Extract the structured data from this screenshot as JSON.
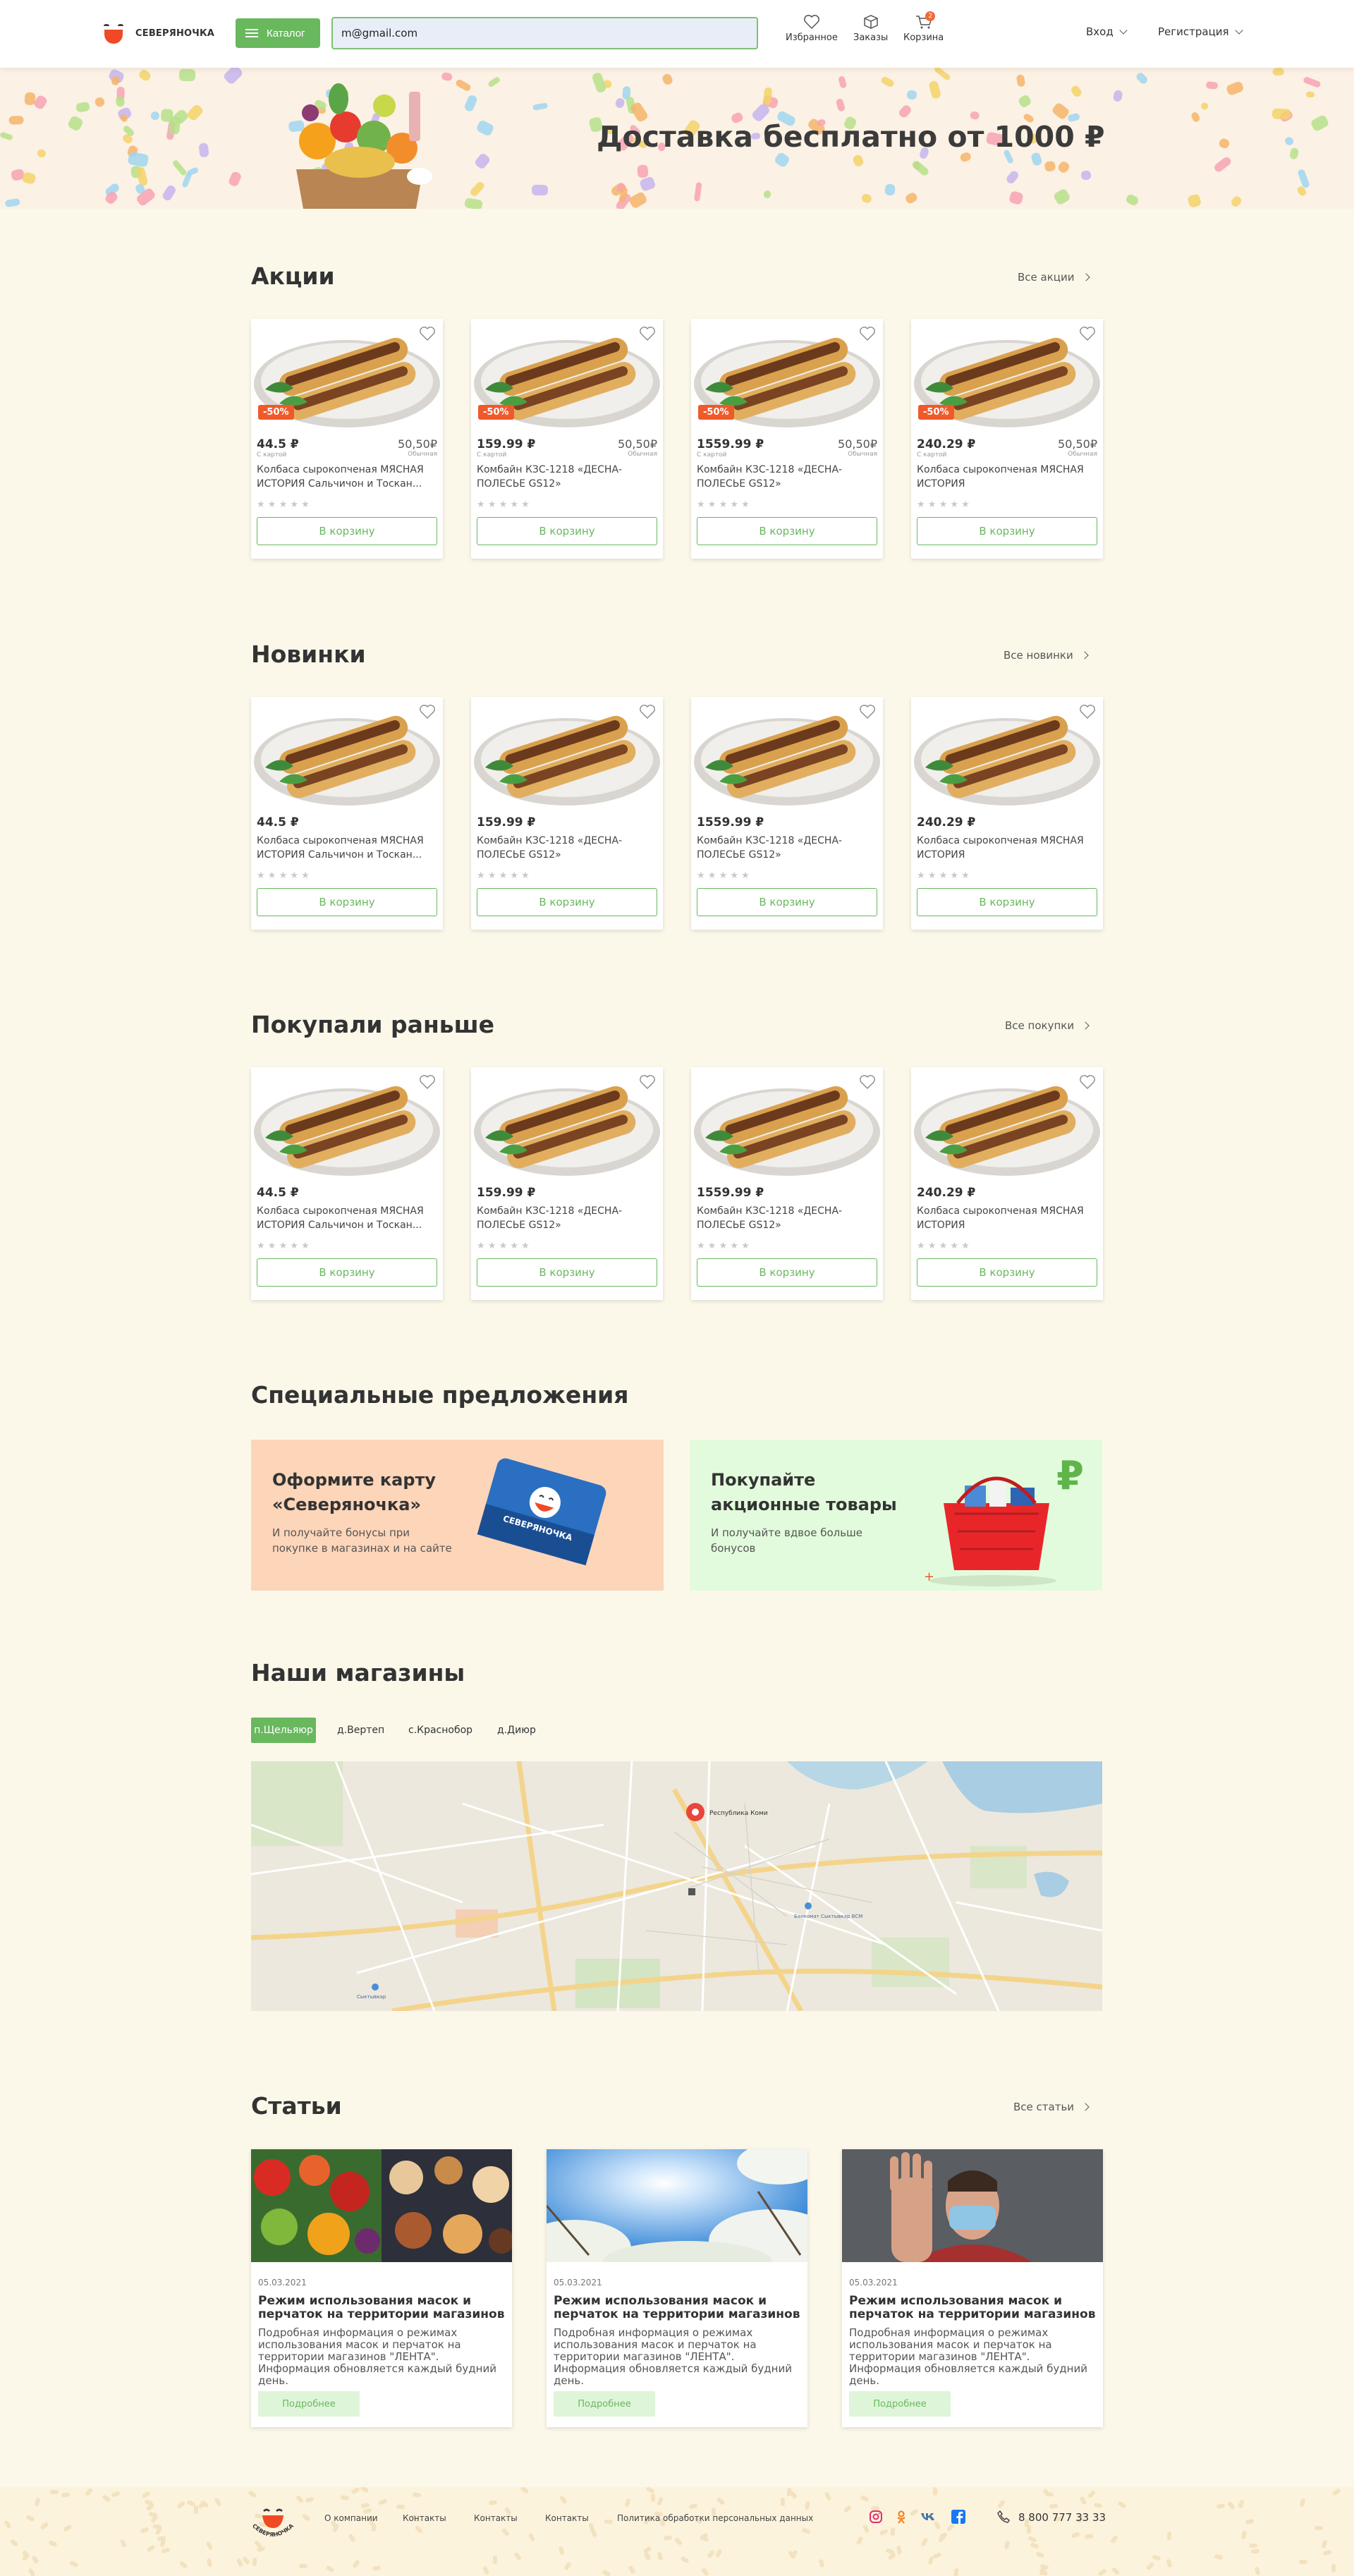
{
  "header": {
    "logo_text": "СЕВЕРЯНОЧКА",
    "catalog_label": "Каталог",
    "search_value": "m@gmail.com",
    "favorites_label": "Избранное",
    "orders_label": "Заказы",
    "cart_label": "Корзина",
    "cart_count": "2",
    "login_label": "Вход",
    "register_label": "Регистрация"
  },
  "hero": {
    "title": "Доставка бесплатно от 1000 ₽"
  },
  "sections": {
    "sales": {
      "title": "Акции",
      "link": "Все акции"
    },
    "new": {
      "title": "Новинки",
      "link": "Все новинки"
    },
    "bought": {
      "title": "Покупали раньше",
      "link": "Все покупки"
    },
    "special": {
      "title": "Специальные предложения"
    },
    "stores": {
      "title": "Наши магазины"
    },
    "articles": {
      "title": "Статьи",
      "link": "Все статьи"
    }
  },
  "products": [
    {
      "price": "44.5 ₽",
      "price_note": "С картой",
      "old": "50,50₽",
      "old_note": "Обычная",
      "discount": "-50%",
      "name": "Колбаса сырокопченая МЯСНАЯ ИСТОРИЯ Сальчичон и Тоскан..."
    },
    {
      "price": "159.99 ₽",
      "price_note": "С картой",
      "old": "50,50₽",
      "old_note": "Обычная",
      "discount": "-50%",
      "name": "Комбайн КЗС-1218 «ДЕСНА-ПОЛЕСЬЕ GS12»"
    },
    {
      "price": "1559.99 ₽",
      "price_note": "С картой",
      "old": "50,50₽",
      "old_note": "Обычная",
      "discount": "-50%",
      "name": "Комбайн КЗС-1218 «ДЕСНА-ПОЛЕСЬЕ GS12»"
    },
    {
      "price": "240.29 ₽",
      "price_note": "С картой",
      "old": "50,50₽",
      "old_note": "Обычная",
      "discount": "-50%",
      "name": "Колбаса сырокопченая МЯСНАЯ ИСТОРИЯ"
    }
  ],
  "stars": "★ ★ ★ ★ ★",
  "add_to_cart": "В корзину",
  "offers": [
    {
      "title": "Оформите карту «Северяночка»",
      "text": "И получайте бонусы при покупке в магазинах и на сайте",
      "color": "#fdd5b9"
    },
    {
      "title": "Покупайте акционные товары",
      "text": "И получайте вдвое больше бонусов",
      "color": "#e2fbdc"
    }
  ],
  "card_logo_text": "СЕВЕРЯНОЧКА",
  "store_tabs": [
    "п.Щельяюр",
    "д.Вертеп",
    "с.Краснобор",
    "д.Диюр"
  ],
  "map": {
    "marker_label": "Республика Коми",
    "stop_label": "Банкомат Сыктывкар ВСМ",
    "town_label": "Сыктывкар"
  },
  "articles": [
    {
      "date": "05.03.2021",
      "title": "Режим использования масок и перчаток на территории магазинов",
      "text": "Подробная информация о режимах использования масок и перчаток на территории магазинов \"ЛЕНТА\". Информация обновляется каждый будний день.",
      "more": "Подробнее"
    },
    {
      "date": "05.03.2021",
      "title": "Режим использования масок и перчаток на территории магазинов",
      "text": "Подробная информация о режимах использования масок и перчаток на территории магазинов \"ЛЕНТА\". Информация обновляется каждый будний день.",
      "more": "Подробнее"
    },
    {
      "date": "05.03.2021",
      "title": "Режим использования масок и перчаток на территории магазинов",
      "text": "Подробная информация о режимах использования масок и перчаток на территории магазинов \"ЛЕНТА\". Информация обновляется каждый будний день.",
      "more": "Подробнее"
    }
  ],
  "footer": {
    "logo_text": "СЕВЕРЯНОЧКА",
    "links": [
      "О компании",
      "Контакты",
      "Контакты",
      "Контакты",
      "Политика обработки персональных данных"
    ],
    "phone": "8 800 777 33 33",
    "social": [
      "instagram-icon",
      "odnoklassniki-icon",
      "vk-icon",
      "facebook-icon"
    ]
  },
  "colors": {
    "accent": "#69b85e",
    "discount": "#ef5a2a",
    "background": "#fbf8ea",
    "brand_red": "#ef4a25"
  }
}
